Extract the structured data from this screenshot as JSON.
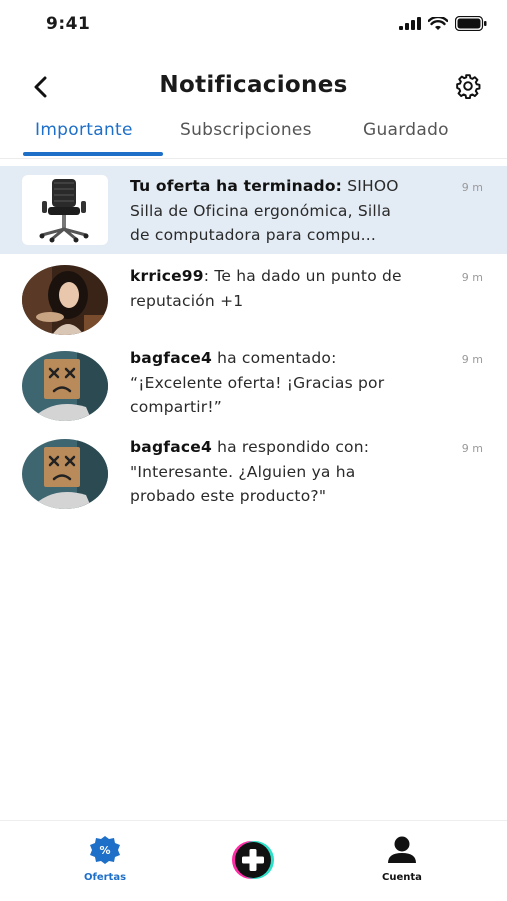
{
  "status_bar": {
    "time": "9:41"
  },
  "header": {
    "title": "Notificaciones"
  },
  "tabs": [
    {
      "label": "Importante",
      "active": true
    },
    {
      "label": "Subscripciones",
      "active": false
    },
    {
      "label": "Guardado",
      "active": false
    }
  ],
  "notifications": [
    {
      "bold": "Tu oferta ha terminado:",
      "line1_rest": " SIHOO",
      "line2": "Silla de Oficina ergonómica, Silla",
      "line3": "de computadora para compu...",
      "time": "9 m",
      "image": "office-chair-thumbnail"
    },
    {
      "bold": "krrice99",
      "line1_rest": ": Te ha dado un punto de",
      "line2": "reputación +1",
      "line3": "",
      "time": "9 m",
      "image": "user-avatar-photo"
    },
    {
      "bold": "bagface4",
      "line1_rest": " ha comentado:",
      "line2": "“¡Excelente oferta! ¡Gracias por",
      "line3": "compartir!”",
      "time": "9 m",
      "image": "paper-bag-avatar"
    },
    {
      "bold": "bagface4",
      "line1_rest": " ha respondido con:",
      "line2": "\"Interesante. ¿Alguien ya ha",
      "line3": "probado este producto?\"",
      "time": "9 m",
      "image": "paper-bag-avatar"
    }
  ],
  "bottom_nav": {
    "ofertas_label": "Ofertas",
    "cuenta_label": "Cuenta"
  },
  "colors": {
    "accent": "#1e6fc8",
    "highlight_row": "#e3ebf4"
  }
}
